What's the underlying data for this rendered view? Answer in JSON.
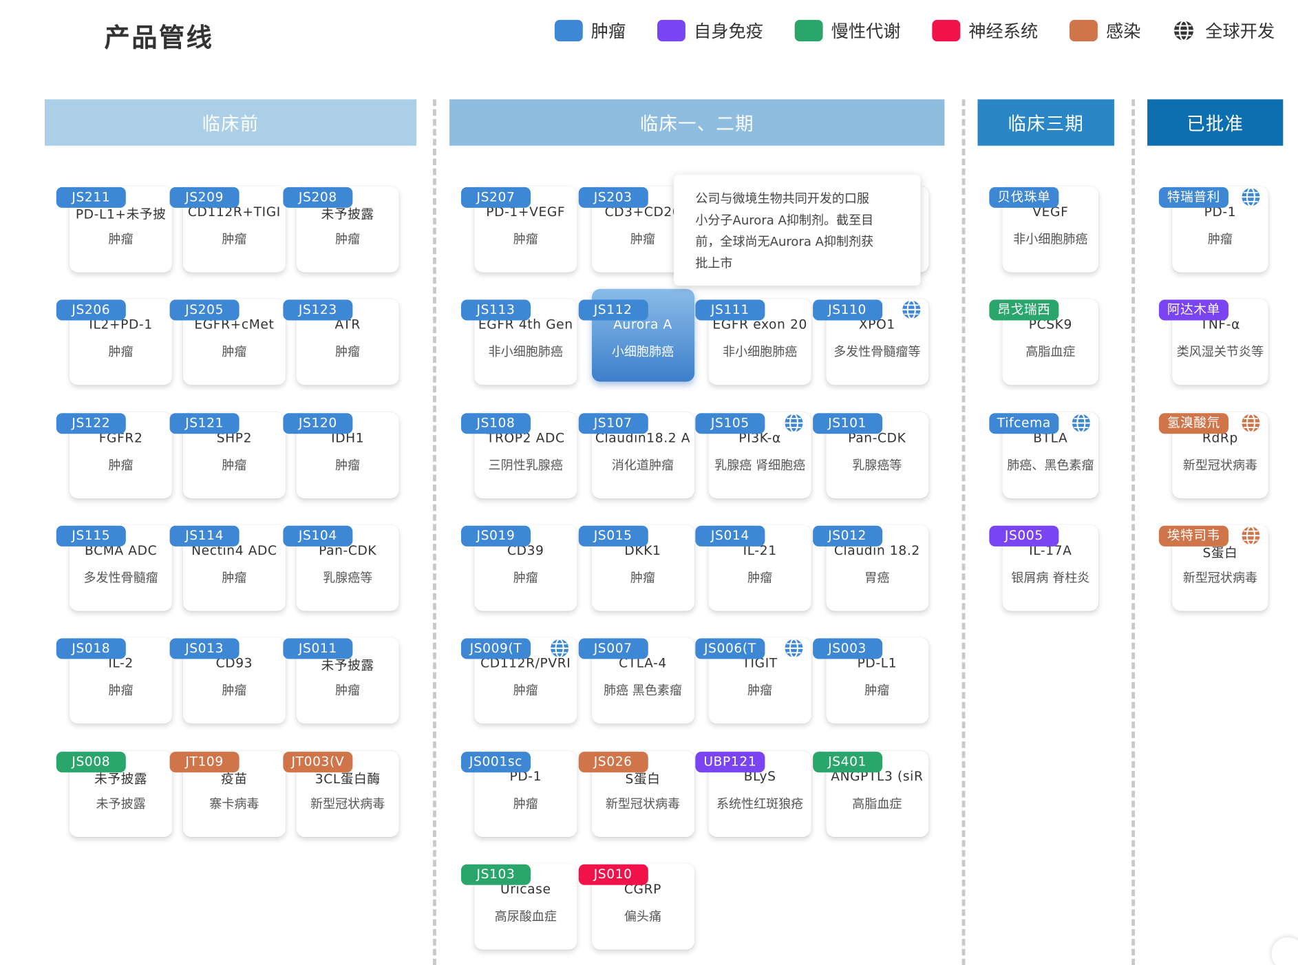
{
  "page": {
    "title": "产品管线"
  },
  "legend": [
    {
      "label": "肿瘤",
      "color": "#3d87d4",
      "icon": "swatch"
    },
    {
      "label": "自身免疫",
      "color": "#7a44f2",
      "icon": "swatch"
    },
    {
      "label": "慢性代谢",
      "color": "#2aa56c",
      "icon": "swatch"
    },
    {
      "label": "神经系统",
      "color": "#f2124a",
      "icon": "swatch"
    },
    {
      "label": "感染",
      "color": "#d0754a",
      "icon": "swatch"
    },
    {
      "label": "全球开发",
      "color": "#333333",
      "icon": "globe-icon"
    }
  ],
  "stages": [
    {
      "label": "临床前",
      "color": "#aacfe6"
    },
    {
      "label": "临床一、二期",
      "color": "#8ebddf"
    },
    {
      "label": "临床三期",
      "color": "#2a86c6"
    },
    {
      "label": "已批准",
      "color": "#0e6fb0"
    }
  ],
  "columns": [
    {
      "stage": "临床前",
      "cards": [
        {
          "code": "JS211",
          "target": "PD-L1+未予披",
          "indication": "肿瘤",
          "category": "肿瘤",
          "global": false
        },
        {
          "code": "JS209",
          "target": "CD112R+TIGI",
          "indication": "肿瘤",
          "category": "肿瘤",
          "global": false
        },
        {
          "code": "JS208",
          "target": "未予披露",
          "indication": "肿瘤",
          "category": "肿瘤",
          "global": false
        },
        {
          "code": "JS206",
          "target": "IL2+PD-1",
          "indication": "肿瘤",
          "category": "肿瘤",
          "global": false
        },
        {
          "code": "JS205",
          "target": "EGFR+cMet",
          "indication": "肿瘤",
          "category": "肿瘤",
          "global": false
        },
        {
          "code": "JS123",
          "target": "ATR",
          "indication": "肿瘤",
          "category": "肿瘤",
          "global": false
        },
        {
          "code": "JS122",
          "target": "FGFR2",
          "indication": "肿瘤",
          "category": "肿瘤",
          "global": false
        },
        {
          "code": "JS121",
          "target": "SHP2",
          "indication": "肿瘤",
          "category": "肿瘤",
          "global": false
        },
        {
          "code": "JS120",
          "target": "IDH1",
          "indication": "肿瘤",
          "category": "肿瘤",
          "global": false
        },
        {
          "code": "JS115",
          "target": "BCMA ADC",
          "indication": "多发性骨髓瘤",
          "category": "肿瘤",
          "global": false
        },
        {
          "code": "JS114",
          "target": "Nectin4 ADC",
          "indication": "肿瘤",
          "category": "肿瘤",
          "global": false
        },
        {
          "code": "JS104",
          "target": "Pan-CDK",
          "indication": "乳腺癌等",
          "category": "肿瘤",
          "global": false
        },
        {
          "code": "JS018",
          "target": "IL-2",
          "indication": "肿瘤",
          "category": "肿瘤",
          "global": false
        },
        {
          "code": "JS013",
          "target": "CD93",
          "indication": "肿瘤",
          "category": "肿瘤",
          "global": false
        },
        {
          "code": "JS011",
          "target": "未予披露",
          "indication": "肿瘤",
          "category": "肿瘤",
          "global": false
        },
        {
          "code": "JS008",
          "target": "未予披露",
          "indication": "未予披露",
          "category": "慢性代谢",
          "global": false
        },
        {
          "code": "JT109",
          "target": "疫苗",
          "indication": "寨卡病毒",
          "category": "感染",
          "global": false
        },
        {
          "code": "JT003(V",
          "target": "3CL蛋白酶",
          "indication": "新型冠状病毒",
          "category": "感染",
          "global": false
        }
      ]
    },
    {
      "stage": "临床一、二期",
      "cards": [
        {
          "code": "JS207",
          "target": "PD-1+VEGF",
          "indication": "肿瘤",
          "category": "肿瘤",
          "global": false
        },
        {
          "code": "JS203",
          "target": "CD3+CD20",
          "indication": "肿瘤",
          "category": "肿瘤",
          "global": false
        },
        {
          "code": "",
          "target": "",
          "indication": "",
          "category": "肿瘤",
          "global": false,
          "hidden": true
        },
        {
          "code": "",
          "target": "",
          "indication": "",
          "category": "肿瘤",
          "global": false,
          "hidden": true
        },
        {
          "code": "JS113",
          "target": "EGFR 4th Gen",
          "indication": "非小细胞肺癌",
          "category": "肿瘤",
          "global": false
        },
        {
          "code": "JS112",
          "target": "Aurora A",
          "indication": "小细胞肺癌",
          "category": "肿瘤",
          "global": false,
          "active": true
        },
        {
          "code": "JS111",
          "target": "EGFR exon 20",
          "indication": "非小细胞肺癌",
          "category": "肿瘤",
          "global": false
        },
        {
          "code": "JS110",
          "target": "XPO1",
          "indication": "多发性骨髓瘤等",
          "category": "肿瘤",
          "global": true
        },
        {
          "code": "JS108",
          "target": "TROP2 ADC",
          "indication": "三阴性乳腺癌",
          "category": "肿瘤",
          "global": false
        },
        {
          "code": "JS107",
          "target": "Claudin18.2 A",
          "indication": "消化道肿瘤",
          "category": "肿瘤",
          "global": false
        },
        {
          "code": "JS105",
          "target": "PI3K-α",
          "indication": "乳腺癌 肾细胞癌",
          "category": "肿瘤",
          "global": true
        },
        {
          "code": "JS101",
          "target": "Pan-CDK",
          "indication": "乳腺癌等",
          "category": "肿瘤",
          "global": false
        },
        {
          "code": "JS019",
          "target": "CD39",
          "indication": "肿瘤",
          "category": "肿瘤",
          "global": false
        },
        {
          "code": "JS015",
          "target": "DKK1",
          "indication": "肿瘤",
          "category": "肿瘤",
          "global": false
        },
        {
          "code": "JS014",
          "target": "IL-21",
          "indication": "肿瘤",
          "category": "肿瘤",
          "global": false
        },
        {
          "code": "JS012",
          "target": "Claudin 18.2",
          "indication": "胃癌",
          "category": "肿瘤",
          "global": false
        },
        {
          "code": "JS009(T",
          "target": "CD112R/PVRI",
          "indication": "肿瘤",
          "category": "肿瘤",
          "global": true
        },
        {
          "code": "JS007",
          "target": "CTLA-4",
          "indication": "肺癌 黑色素瘤",
          "category": "肿瘤",
          "global": false
        },
        {
          "code": "JS006(T",
          "target": "TIGIT",
          "indication": "肿瘤",
          "category": "肿瘤",
          "global": true
        },
        {
          "code": "JS003",
          "target": "PD-L1",
          "indication": "肿瘤",
          "category": "肿瘤",
          "global": false
        },
        {
          "code": "JS001sc",
          "target": "PD-1",
          "indication": "肿瘤",
          "category": "肿瘤",
          "global": false
        },
        {
          "code": "JS026",
          "target": "S蛋白",
          "indication": "新型冠状病毒",
          "category": "感染",
          "global": false
        },
        {
          "code": "UBP121",
          "target": "BLyS",
          "indication": "系统性红斑狼疮",
          "category": "自身免疫",
          "global": false
        },
        {
          "code": "JS401",
          "target": "ANGPTL3 (siR",
          "indication": "高脂血症",
          "category": "慢性代谢",
          "global": false
        },
        {
          "code": "JS103",
          "target": "Uricase",
          "indication": "高尿酸血症",
          "category": "慢性代谢",
          "global": false
        },
        {
          "code": "JS010",
          "target": "CGRP",
          "indication": "偏头痛",
          "category": "神经系统",
          "global": false
        }
      ]
    },
    {
      "stage": "临床三期",
      "cards": [
        {
          "code": "贝伐珠单",
          "target": "VEGF",
          "indication": "非小细胞肺癌",
          "category": "肿瘤",
          "global": false
        },
        {
          "code": "昂戈瑞西",
          "target": "PCSK9",
          "indication": "高脂血症",
          "category": "慢性代谢",
          "global": false
        },
        {
          "code": "Tifcema",
          "target": "BTLA",
          "indication": "肺癌、黑色素瘤",
          "category": "肿瘤",
          "global": true
        },
        {
          "code": "JS005",
          "target": "IL-17A",
          "indication": "银屑病 脊柱炎",
          "category": "自身免疫",
          "global": false
        }
      ]
    },
    {
      "stage": "已批准",
      "cards": [
        {
          "code": "特瑞普利",
          "target": "PD-1",
          "indication": "肿瘤",
          "category": "肿瘤",
          "global": true
        },
        {
          "code": "阿达木单",
          "target": "TNF-α",
          "indication": "类风湿关节炎等",
          "category": "自身免疫",
          "global": false
        },
        {
          "code": "氢溴酸氘",
          "target": "RdRp",
          "indication": "新型冠状病毒",
          "category": "感染",
          "global": true
        },
        {
          "code": "埃特司韦",
          "target": "S蛋白",
          "indication": "新型冠状病毒",
          "category": "感染",
          "global": true
        }
      ]
    }
  ],
  "tooltip": {
    "lines": [
      "公司与微境生物共同开发的口服",
      "小分子Aurora A抑制剂。截至目",
      "前，全球尚无Aurora A抑制剂获",
      "批上市"
    ]
  }
}
